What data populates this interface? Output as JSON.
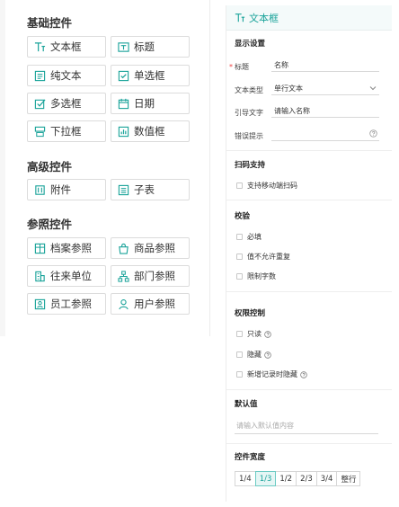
{
  "palette": {
    "basic_title": "基础控件",
    "basic_items": [
      {
        "label": "文本框",
        "icon": "text-box-icon"
      },
      {
        "label": "标题",
        "icon": "title-icon"
      },
      {
        "label": "纯文本",
        "icon": "plain-text-icon"
      },
      {
        "label": "单选框",
        "icon": "radio-icon"
      },
      {
        "label": "多选框",
        "icon": "checkbox-icon"
      },
      {
        "label": "日期",
        "icon": "calendar-icon"
      },
      {
        "label": "下拉框",
        "icon": "dropdown-icon"
      },
      {
        "label": "数值框",
        "icon": "chart-icon"
      }
    ],
    "advanced_title": "高级控件",
    "advanced_items": [
      {
        "label": "附件",
        "icon": "attachment-icon"
      },
      {
        "label": "子表",
        "icon": "subtable-icon"
      }
    ],
    "reference_title": "参照控件",
    "reference_items": [
      {
        "label": "档案参照",
        "icon": "archive-icon"
      },
      {
        "label": "商品参照",
        "icon": "bag-icon"
      },
      {
        "label": "往来单位",
        "icon": "building-icon"
      },
      {
        "label": "部门参照",
        "icon": "org-icon"
      },
      {
        "label": "员工参照",
        "icon": "employee-icon"
      },
      {
        "label": "用户参照",
        "icon": "user-icon"
      }
    ],
    "accent": "#1aa39a"
  },
  "props": {
    "header": "文本框",
    "display_title": "显示设置",
    "required_mark": "*",
    "title_label": "标题",
    "title_value": "名称",
    "text_type_label": "文本类型",
    "text_type_value": "单行文本",
    "guide_label": "引导文字",
    "guide_value": "请输入名称",
    "error_label": "错误提示",
    "scan_title": "扫码支持",
    "scan_option": "支持移动端扫码",
    "validate_title": "校验",
    "validate_options": [
      "必填",
      "值不允许重复",
      "限制字数"
    ],
    "permission_title": "权限控制",
    "permission_options": [
      "只读",
      "隐藏",
      "新增记录时隐藏"
    ],
    "default_title": "默认值",
    "default_placeholder": "请输入默认值内容",
    "width_title": "控件宽度",
    "width_options": [
      "1/4",
      "1/3",
      "1/2",
      "2/3",
      "3/4",
      "整行"
    ],
    "width_selected": "1/3"
  }
}
